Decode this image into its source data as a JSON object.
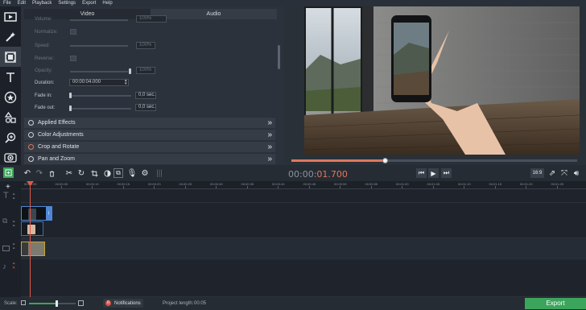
{
  "menu": [
    "File",
    "Edit",
    "Playback",
    "Settings",
    "Export",
    "Help"
  ],
  "tabs": {
    "video": "Video",
    "audio": "Audio"
  },
  "properties": {
    "volume": "Volume:",
    "volume_value": "100%",
    "normalize": "Normalize:",
    "speed": "Speed:",
    "speed_value": "100%",
    "reverse": "Reverse:",
    "opacity": "Opacity:",
    "opacity_value": "100%",
    "duration": "Duration:",
    "duration_value": "00:00:04.000",
    "fade_in": "Fade in:",
    "fade_in_value": "0,0 sec.",
    "fade_out": "Fade out:",
    "fade_out_value": "0,0 sec."
  },
  "sections": {
    "applied_effects": "Applied Effects",
    "color_adjustments": "Color Adjustments",
    "crop_rotate": "Crop and Rotate",
    "pan_zoom": "Pan and Zoom"
  },
  "timecode": {
    "gray": "00:00:",
    "red": "01.700"
  },
  "aspect_ratio": "16:9",
  "ruler_labels": [
    "00:00:00",
    "00:00:05",
    "00:00:10",
    "00:00:15",
    "00:00:20",
    "00:00:25",
    "00:00:30",
    "00:00:35",
    "00:00:40",
    "00:00:45",
    "00:00:50",
    "00:00:55",
    "00:01:00",
    "00:01:05",
    "00:01:10",
    "00:01:15",
    "00:01:20",
    "00:01:25"
  ],
  "status": {
    "scale": "Scale:",
    "notifications": "Notifications",
    "notif_count": "0",
    "project_length": "Project length:",
    "project_length_value": "00:05",
    "export": "Export"
  },
  "playback_progress": 0.327,
  "colors": {
    "accent": "#e0775e",
    "export_green": "#3ba55c",
    "clip_border": "#4e87d6"
  }
}
